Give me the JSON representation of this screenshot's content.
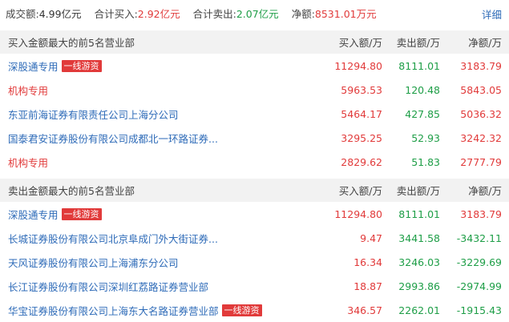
{
  "summary": {
    "turnover_label": "成交额:",
    "turnover_value": "4.99亿元",
    "buy_label": "合计买入:",
    "buy_value": "2.92亿元",
    "sell_label": "合计卖出:",
    "sell_value": "2.07亿元",
    "net_label": "净额:",
    "net_value": "8531.01万元",
    "detail_link": "详细"
  },
  "buy_table": {
    "title": "买入金额最大的前5名营业部",
    "col_buy": "买入额/万",
    "col_sell": "卖出额/万",
    "col_net": "净额/万",
    "rows": [
      {
        "name": "深股通专用",
        "tag": "一线游资",
        "buy": "11294.80",
        "sell": "8111.01",
        "net": "3183.79"
      },
      {
        "name": "机构专用",
        "tag": "",
        "buy": "5963.53",
        "sell": "120.48",
        "net": "5843.05"
      },
      {
        "name": "东亚前海证券有限责任公司上海分公司",
        "tag": "",
        "buy": "5464.17",
        "sell": "427.85",
        "net": "5036.32"
      },
      {
        "name": "国泰君安证券股份有限公司成都北一环路证券...",
        "tag": "",
        "buy": "3295.25",
        "sell": "52.93",
        "net": "3242.32"
      },
      {
        "name": "机构专用",
        "tag": "",
        "buy": "2829.62",
        "sell": "51.83",
        "net": "2777.79"
      }
    ]
  },
  "sell_table": {
    "title": "卖出金额最大的前5名营业部",
    "col_buy": "买入额/万",
    "col_sell": "卖出额/万",
    "col_net": "净额/万",
    "rows": [
      {
        "name": "深股通专用",
        "tag": "一线游资",
        "buy": "11294.80",
        "sell": "8111.01",
        "net": "3183.79"
      },
      {
        "name": "长城证券股份有限公司北京阜成门外大街证券...",
        "tag": "",
        "buy": "9.47",
        "sell": "3441.58",
        "net": "-3432.11"
      },
      {
        "name": "天风证券股份有限公司上海浦东分公司",
        "tag": "",
        "buy": "16.34",
        "sell": "3246.03",
        "net": "-3229.69"
      },
      {
        "name": "长江证券股份有限公司深圳红荔路证券营业部",
        "tag": "",
        "buy": "18.87",
        "sell": "2993.86",
        "net": "-2974.99"
      },
      {
        "name": "华宝证券股份有限公司上海东大名路证券营业部",
        "tag": "一线游资",
        "buy": "346.57",
        "sell": "2262.01",
        "net": "-1915.43"
      }
    ]
  },
  "colors": {
    "up": "#e13a3a",
    "down": "#1e9e47",
    "link": "#2e6bb8",
    "header_bg": "#f2f2f2"
  }
}
